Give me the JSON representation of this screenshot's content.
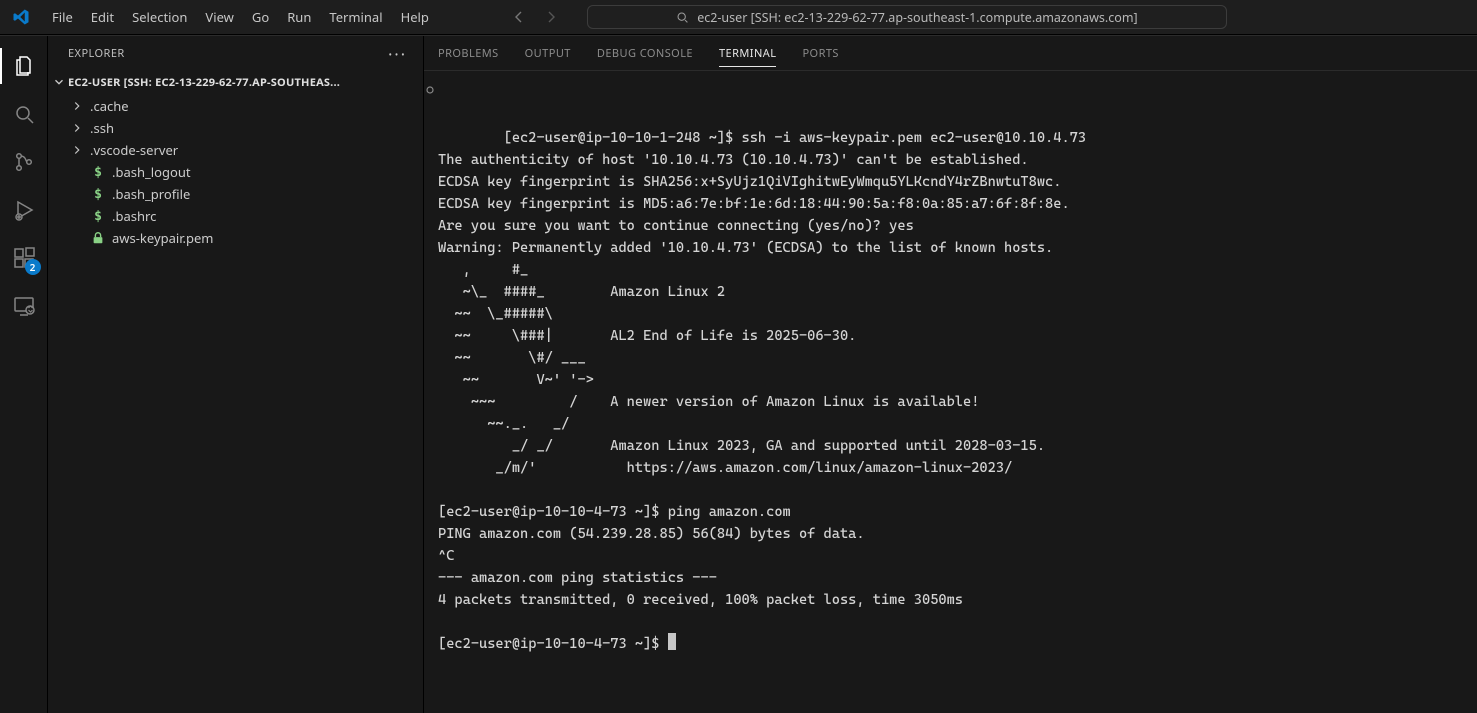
{
  "menu": {
    "items": [
      "File",
      "Edit",
      "Selection",
      "View",
      "Go",
      "Run",
      "Terminal",
      "Help"
    ]
  },
  "search_label": "ec2-user [SSH: ec2-13-229-62-77.ap-southeast-1.compute.amazonaws.com]",
  "activity": {
    "extensions_badge": "2"
  },
  "sidebar": {
    "title": "EXPLORER",
    "section": "EC2-USER [SSH: EC2-13-229-62-77.AP-SOUTHEAS...",
    "tree": [
      {
        "type": "folder",
        "label": ".cache"
      },
      {
        "type": "folder",
        "label": ".ssh"
      },
      {
        "type": "folder",
        "label": ".vscode-server"
      },
      {
        "type": "shfile",
        "label": ".bash_logout"
      },
      {
        "type": "shfile",
        "label": ".bash_profile"
      },
      {
        "type": "shfile",
        "label": ".bashrc"
      },
      {
        "type": "lockfile",
        "label": "aws-keypair.pem"
      }
    ]
  },
  "panel_tabs": {
    "problems": "PROBLEMS",
    "output": "OUTPUT",
    "debug": "DEBUG CONSOLE",
    "terminal": "TERMINAL",
    "ports": "PORTS"
  },
  "terminal_text": "[ec2-user@ip-10-10-1-248 ~]$ ssh -i aws-keypair.pem ec2-user@10.10.4.73\nThe authenticity of host '10.10.4.73 (10.10.4.73)' can't be established.\nECDSA key fingerprint is SHA256:x+SyUjz1QiVIghitwEyWmqu5YLKcndY4rZBnwtuT8wc.\nECDSA key fingerprint is MD5:a6:7e:bf:1e:6d:18:44:90:5a:f8:0a:85:a7:6f:8f:8e.\nAre you sure you want to continue connecting (yes/no)? yes\nWarning: Permanently added '10.10.4.73' (ECDSA) to the list of known hosts.\n   ,     #_\n   ~\\_  ####_        Amazon Linux 2\n  ~~  \\_#####\\\n  ~~     \\###|       AL2 End of Life is 2025-06-30.\n  ~~       \\#/ ___\n   ~~       V~' '->\n    ~~~         /    A newer version of Amazon Linux is available!\n      ~~._.   _/\n         _/ _/       Amazon Linux 2023, GA and supported until 2028-03-15.\n       _/m/'           https://aws.amazon.com/linux/amazon-linux-2023/\n\n[ec2-user@ip-10-10-4-73 ~]$ ping amazon.com\nPING amazon.com (54.239.28.85) 56(84) bytes of data.\n^C\n--- amazon.com ping statistics ---\n4 packets transmitted, 0 received, 100% packet loss, time 3050ms\n\n[ec2-user@ip-10-10-4-73 ~]$ "
}
